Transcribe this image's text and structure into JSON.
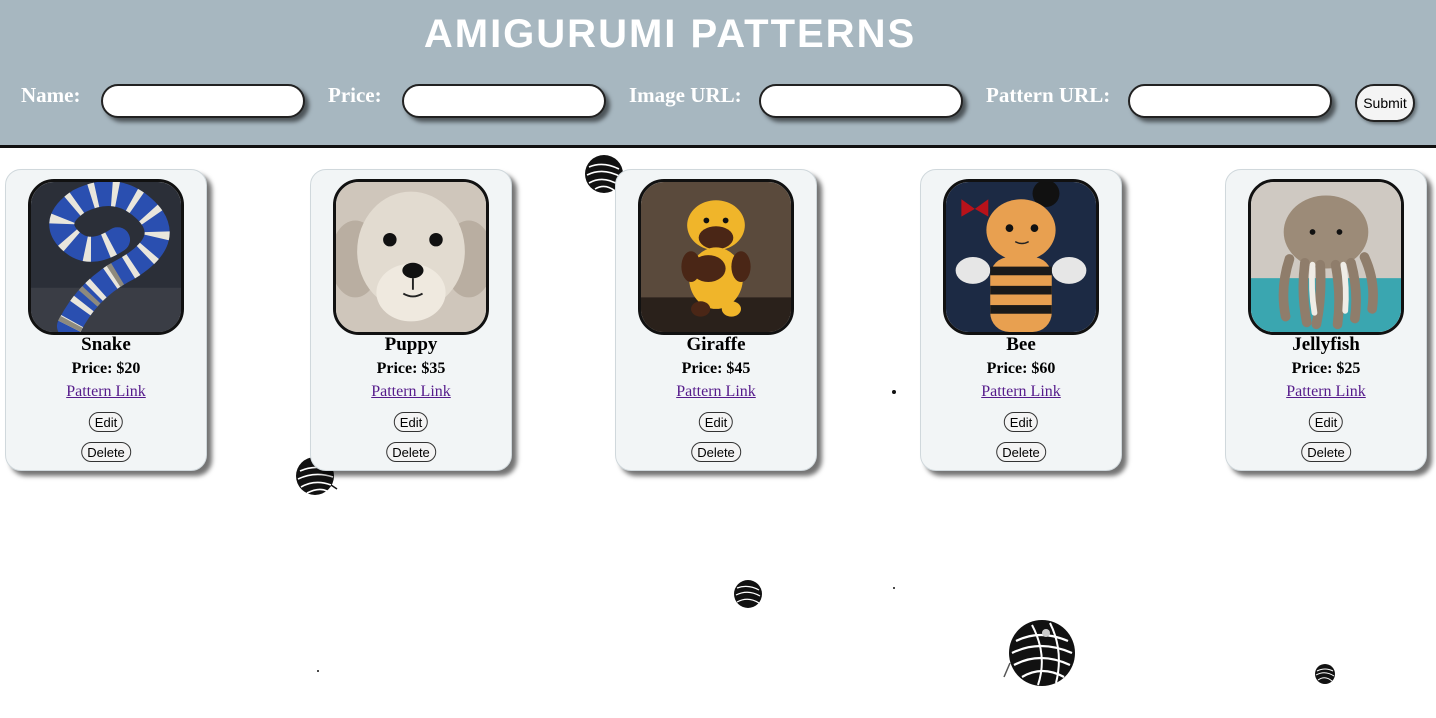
{
  "header": {
    "title": "AMIGURUMI PATTERNS",
    "background_color": "#a7b7c0"
  },
  "form": {
    "name_label": "Name:",
    "name_value": "",
    "price_label": "Price:",
    "price_value": "",
    "image_url_label": "Image URL:",
    "image_url_value": "",
    "pattern_url_label": "Pattern URL:",
    "pattern_url_value": "",
    "submit_label": "Submit"
  },
  "cards": [
    {
      "name": "Snake",
      "price": "Price: $20",
      "link": "Pattern Link",
      "edit": "Edit",
      "delete": "Delete",
      "image": "snake-amigurumi-photo"
    },
    {
      "name": "Puppy",
      "price": "Price: $35",
      "link": "Pattern Link",
      "edit": "Edit",
      "delete": "Delete",
      "image": "puppy-amigurumi-photo"
    },
    {
      "name": "Giraffe",
      "price": "Price: $45",
      "link": "Pattern Link",
      "edit": "Edit",
      "delete": "Delete",
      "image": "giraffe-amigurumi-photo"
    },
    {
      "name": "Bee",
      "price": "Price: $60",
      "link": "Pattern Link",
      "edit": "Edit",
      "delete": "Delete",
      "image": "bee-amigurumi-photo"
    },
    {
      "name": "Jellyfish",
      "price": "Price: $25",
      "link": "Pattern Link",
      "edit": "Edit",
      "delete": "Delete",
      "image": "jellyfish-amigurumi-photo"
    }
  ],
  "decorations": {
    "icon": "yarn-ball-icon"
  },
  "colors": {
    "card_background": "#f2f5f6",
    "link": "#551a8b"
  }
}
